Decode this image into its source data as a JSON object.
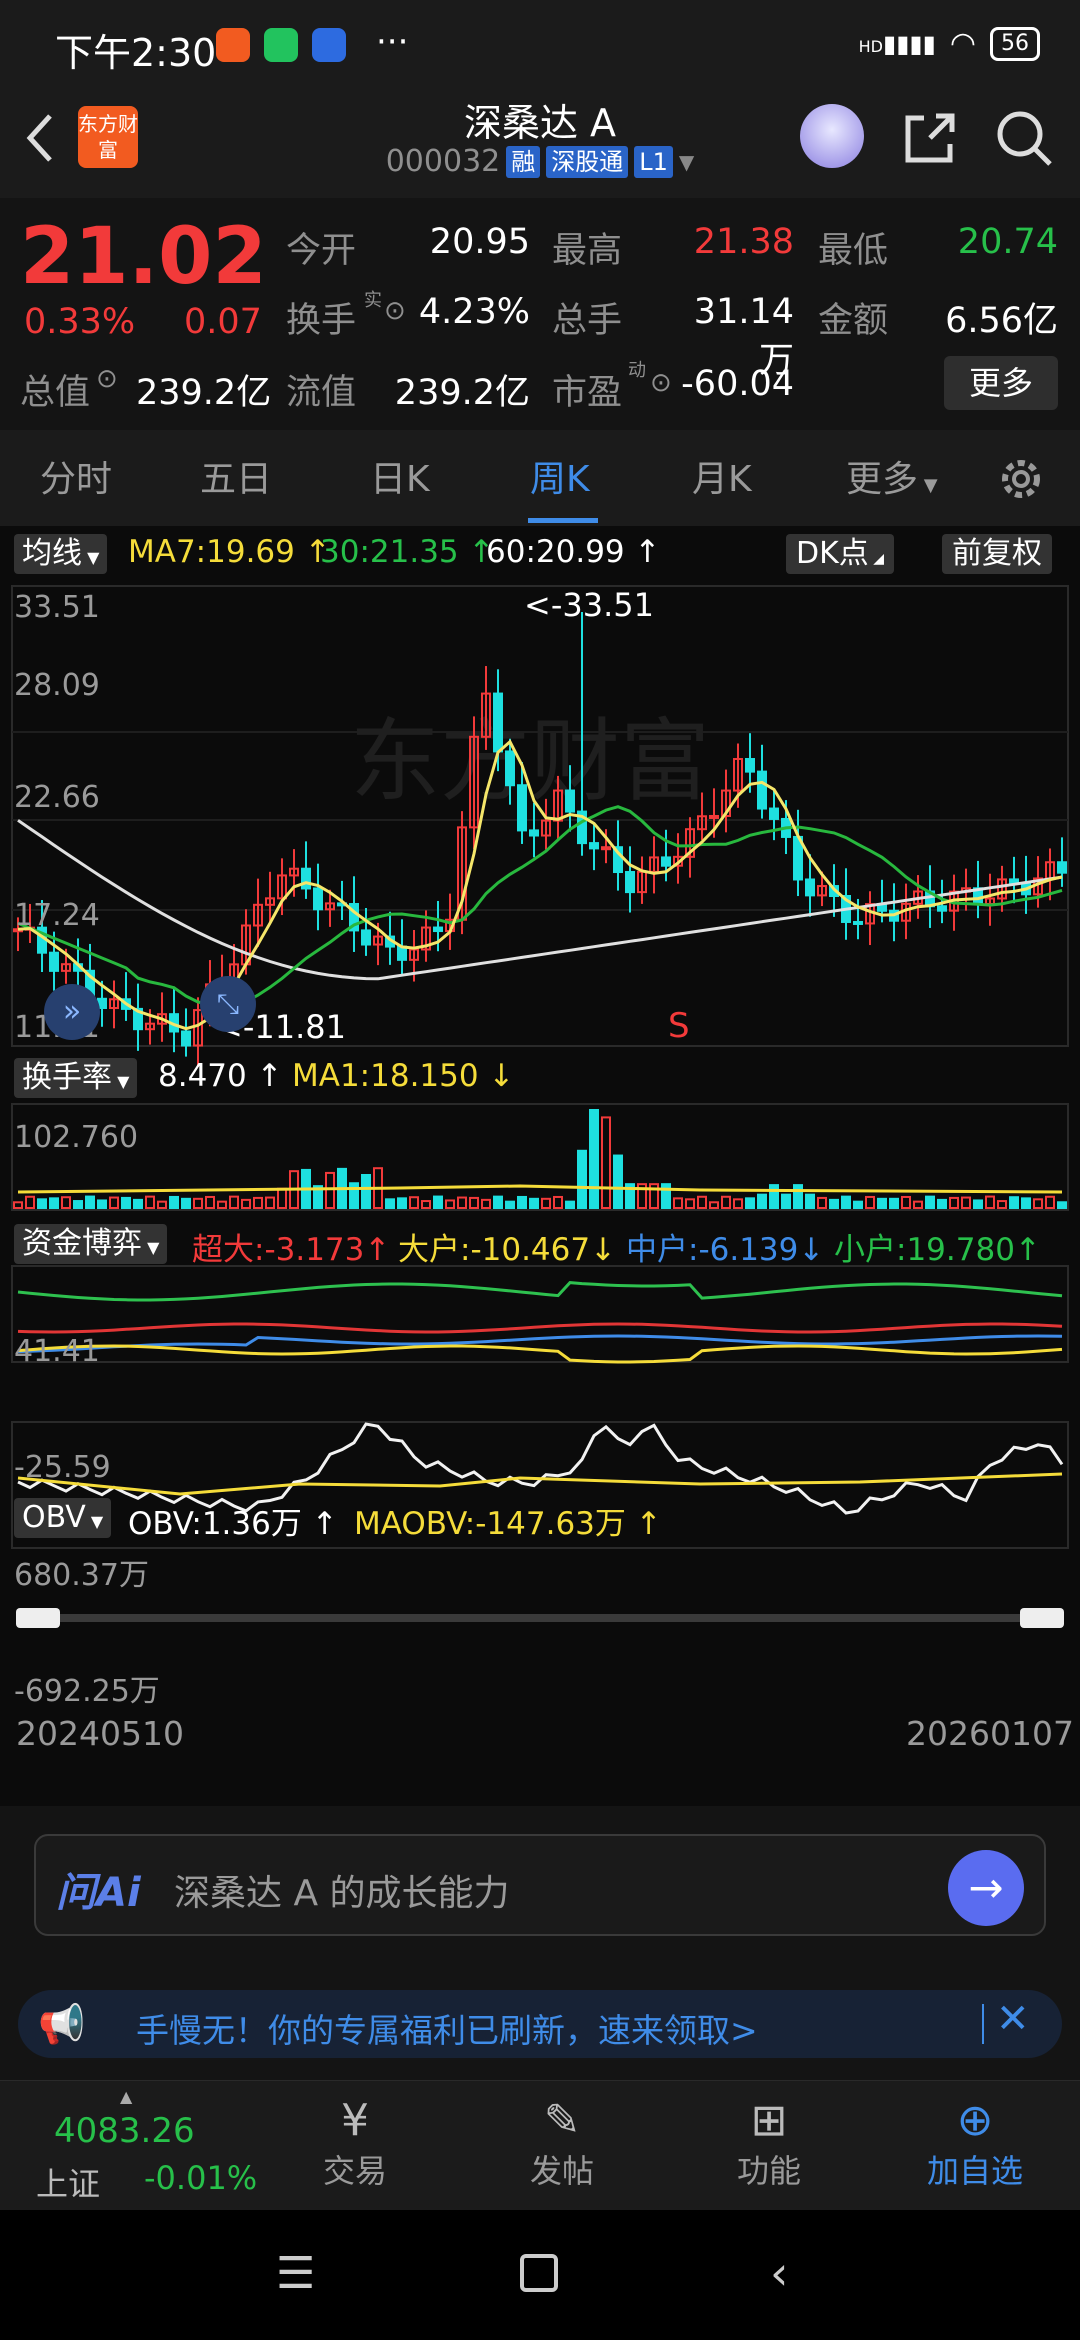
{
  "status": {
    "time": "下午2:30",
    "network": "HD",
    "battery": "56"
  },
  "header": {
    "logo": "东方财富",
    "stock_name": "深桑达 A",
    "stock_code": "000032",
    "tags": [
      "融",
      "深股通",
      "L1"
    ]
  },
  "quote": {
    "price": "21.02",
    "change_pct": "0.33%",
    "change": "0.07",
    "fields": {
      "open_label": "今开",
      "open": "20.95",
      "high_label": "最高",
      "high": "21.38",
      "low_label": "最低",
      "low": "20.74",
      "turnover_label": "换手",
      "turnover_sup": "实",
      "turnover": "4.23%",
      "volume_label": "总手",
      "volume": "31.14万",
      "amount_label": "金额",
      "amount": "6.56亿",
      "mktcap_label": "总值",
      "mktcap": "239.2亿",
      "float_label": "流值",
      "float": "239.2亿",
      "pe_label": "市盈",
      "pe_sup": "动",
      "pe": "-60.04"
    },
    "more_button": "更多"
  },
  "tabs": [
    {
      "label": "分时",
      "active": false
    },
    {
      "label": "五日",
      "active": false
    },
    {
      "label": "日K",
      "active": false
    },
    {
      "label": "周K",
      "active": true
    },
    {
      "label": "月K",
      "active": false
    },
    {
      "label": "更多",
      "active": false
    }
  ],
  "kline": {
    "ma_button": "均线",
    "ma7": "MA7:19.69",
    "ma30": "30:21.35",
    "ma60": "60:20.99",
    "dk_button": "DK点",
    "adjust_button": "前复权",
    "y_labels": [
      "33.51",
      "28.09",
      "22.66",
      "17.24",
      "11.81"
    ],
    "high_marker": "<-33.51",
    "low_marker": "<-11.81",
    "signal": "S"
  },
  "turnover_panel": {
    "button": "换手率",
    "value": "8.470",
    "ma1": "MA1:18.150",
    "y_label": "102.760"
  },
  "fund_panel": {
    "button": "资金博弈",
    "super": "超大:-3.173",
    "large": "大户:-10.467",
    "mid": "中户:-6.139",
    "small": "小户:19.780",
    "y_top": "41.41",
    "y_bottom": "-25.59"
  },
  "obv_panel": {
    "button": "OBV",
    "obv": "OBV:1.36万",
    "maobv": "MAOBV:-147.63万",
    "y_top": "680.37万",
    "y_bottom": "-692.25万",
    "date_start": "20240510",
    "date_end": "20260107"
  },
  "ai": {
    "badge": "问Ai",
    "placeholder": "深桑达 A 的成长能力"
  },
  "banner": {
    "text": "手慢无！你的专属福利已刷新，速来领取>"
  },
  "bottom_bar": {
    "index_value": "4083.26",
    "index_name": "上证",
    "index_change": "-0.01%",
    "items": [
      "交易",
      "发帖",
      "功能",
      "加自选"
    ]
  },
  "colors": {
    "up": "#f23a3a",
    "down": "#27c04a",
    "accent": "#3f8ce8",
    "cyan": "#1ee0e0",
    "yellow": "#f5dc3a"
  }
}
